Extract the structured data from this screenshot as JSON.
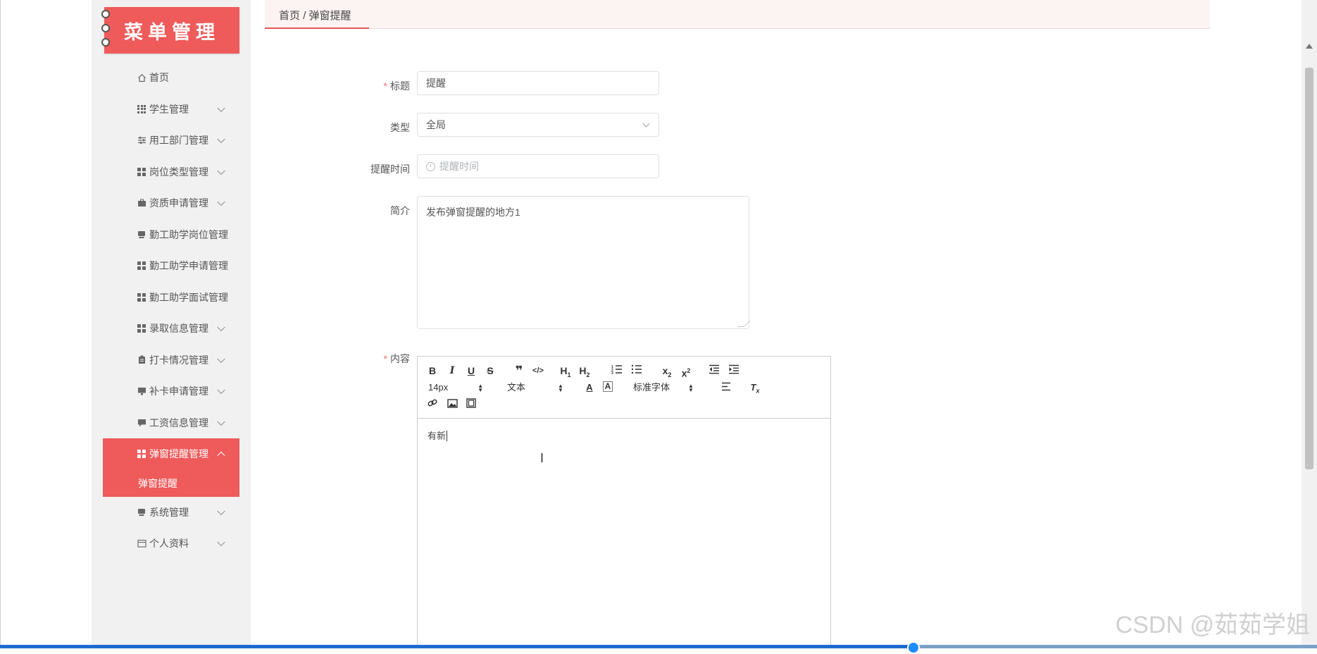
{
  "sidebar": {
    "logo": "菜单管理",
    "items": [
      {
        "label": "首页",
        "icon": "home-icon",
        "chev": false
      },
      {
        "label": "学生管理",
        "icon": "grid-icon",
        "chev": true
      },
      {
        "label": "用工部门管理",
        "icon": "sliders-icon",
        "chev": true
      },
      {
        "label": "岗位类型管理",
        "icon": "grid-icon",
        "chev": true
      },
      {
        "label": "资质申请管理",
        "icon": "briefcase-icon",
        "chev": true
      },
      {
        "label": "勤工助学岗位管理",
        "icon": "card-icon",
        "chev": false
      },
      {
        "label": "勤工助学申请管理",
        "icon": "grid-icon",
        "chev": false
      },
      {
        "label": "勤工助学面试管理",
        "icon": "grid-icon",
        "chev": false
      },
      {
        "label": "录取信息管理",
        "icon": "grid-icon",
        "chev": true
      },
      {
        "label": "打卡情况管理",
        "icon": "clipboard-icon",
        "chev": true
      },
      {
        "label": "补卡申请管理",
        "icon": "monitor-icon",
        "chev": true
      },
      {
        "label": "工资信息管理",
        "icon": "chat-icon",
        "chev": true
      },
      {
        "label": "弹窗提醒管理",
        "icon": "grid-icon",
        "chev": true,
        "active": true
      },
      {
        "label": "系统管理",
        "icon": "card-icon",
        "chev": true
      },
      {
        "label": "个人资料",
        "icon": "calendar-icon",
        "chev": true
      }
    ],
    "submenu_label": "弹窗提醒"
  },
  "breadcrumb": {
    "home": "首页",
    "sep": "/",
    "current": "弹窗提醒"
  },
  "form": {
    "title_label": "标题",
    "title_value": "提醒",
    "type_label": "类型",
    "type_value": "全局",
    "time_label": "提醒时间",
    "time_placeholder": "提醒时间",
    "intro_label": "简介",
    "intro_value": "发布弹窗提醒的地方1",
    "content_label": "内容"
  },
  "editor": {
    "font_size": "14px",
    "header_picker": "文本",
    "font_family": "标准字体",
    "content": "有新"
  },
  "watermark": "CSDN @茹茹学姐",
  "colors": {
    "accent": "#ef5a5a",
    "required": "#f56c6c"
  }
}
